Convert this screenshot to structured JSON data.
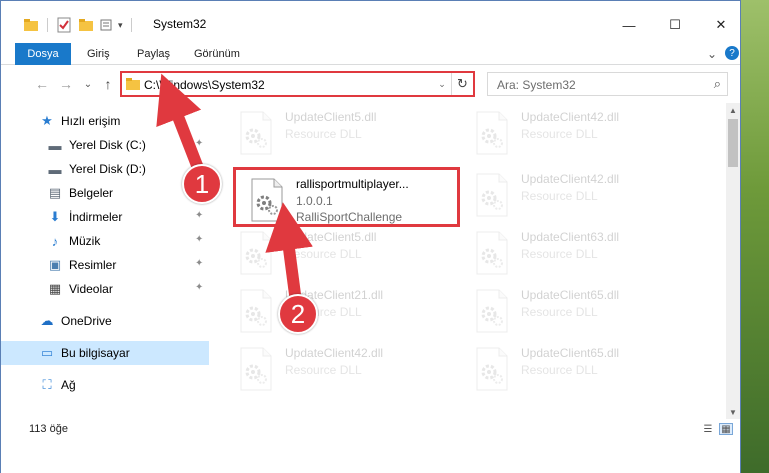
{
  "window": {
    "title": "System32",
    "minimize_glyph": "—",
    "maximize_glyph": "☐",
    "close_glyph": "✕"
  },
  "ribbon": {
    "tabs": [
      "Dosya",
      "Giriş",
      "Paylaş",
      "Görünüm"
    ],
    "expand_glyph": "⌄",
    "help_glyph": "?"
  },
  "nav": {
    "back_glyph": "←",
    "forward_glyph": "→",
    "recent_glyph": "⌄",
    "up_glyph": "↑"
  },
  "address": {
    "path": "C:\\Windows\\System32",
    "refresh_glyph": "↻",
    "dropdown_glyph": "⌄"
  },
  "search": {
    "placeholder": "Ara: System32",
    "icon_glyph": "⌕"
  },
  "sidebar": {
    "items": [
      {
        "label": "Hızlı erişim",
        "icon": "star-icon",
        "glyph": "★",
        "color": "#2a7dd1",
        "pinned": false,
        "level": 0
      },
      {
        "label": "Yerel Disk (C:)",
        "icon": "drive-icon",
        "glyph": "▬",
        "color": "#5f6b78",
        "pinned": true,
        "level": 1
      },
      {
        "label": "Yerel Disk (D:)",
        "icon": "drive-icon",
        "glyph": "▬",
        "color": "#5f6b78",
        "pinned": false,
        "level": 1
      },
      {
        "label": "Belgeler",
        "icon": "documents-icon",
        "glyph": "▤",
        "color": "#5f6b78",
        "pinned": true,
        "level": 1
      },
      {
        "label": "İndirmeler",
        "icon": "download-icon",
        "glyph": "⬇",
        "color": "#2a7dd1",
        "pinned": true,
        "level": 1
      },
      {
        "label": "Müzik",
        "icon": "music-icon",
        "glyph": "♪",
        "color": "#2a7dd1",
        "pinned": true,
        "level": 1
      },
      {
        "label": "Resimler",
        "icon": "pictures-icon",
        "glyph": "▣",
        "color": "#4c7fb0",
        "pinned": true,
        "level": 1
      },
      {
        "label": "Videolar",
        "icon": "videos-icon",
        "glyph": "▦",
        "color": "#444",
        "pinned": true,
        "level": 1
      },
      {
        "label": "OneDrive",
        "icon": "cloud-icon",
        "glyph": "☁",
        "color": "#1f6fc5",
        "pinned": false,
        "level": 0
      },
      {
        "label": "Bu bilgisayar",
        "icon": "computer-icon",
        "glyph": "▭",
        "color": "#3a88d8",
        "pinned": false,
        "level": 0,
        "selected": true
      },
      {
        "label": "Ağ",
        "icon": "network-icon",
        "glyph": "⛶",
        "color": "#3a88d8",
        "pinned": false,
        "level": 0
      }
    ],
    "pin_glyph": "📌"
  },
  "files": [
    {
      "name": "UpdateClient5.dll",
      "line1": "Resource DLL",
      "line2": "",
      "faded": true
    },
    {
      "name": "UpdateClient42.dll",
      "line1": "Resource DLL",
      "line2": "",
      "faded": true
    },
    {
      "name": "rallisportmultiplayer...",
      "line1": "1.0.0.1",
      "line2": "RalliSportChallenge",
      "faded": false,
      "highlighted": true
    },
    {
      "name": "UpdateClient42.dll",
      "line1": "Resource DLL",
      "line2": "",
      "faded": true
    },
    {
      "name": "UpdateClient5.dll",
      "line1": "Resource DLL",
      "line2": "",
      "faded": true
    },
    {
      "name": "UpdateClient63.dll",
      "line1": "Resource DLL",
      "line2": "",
      "faded": true
    },
    {
      "name": "UpdateClient21.dll",
      "line1": "Resource DLL",
      "line2": "",
      "faded": true
    },
    {
      "name": "UpdateClient65.dll",
      "line1": "Resource DLL",
      "line2": "",
      "faded": true
    },
    {
      "name": "UpdateClient42.dll",
      "line1": "Resource DLL",
      "line2": "",
      "faded": true
    },
    {
      "name": "UpdateClient65.dll",
      "line1": "Resource DLL",
      "line2": "",
      "faded": true
    }
  ],
  "status": {
    "item_count": "113 öğe"
  },
  "annotations": {
    "step1": "1",
    "step2": "2",
    "color": "#e0393f"
  }
}
